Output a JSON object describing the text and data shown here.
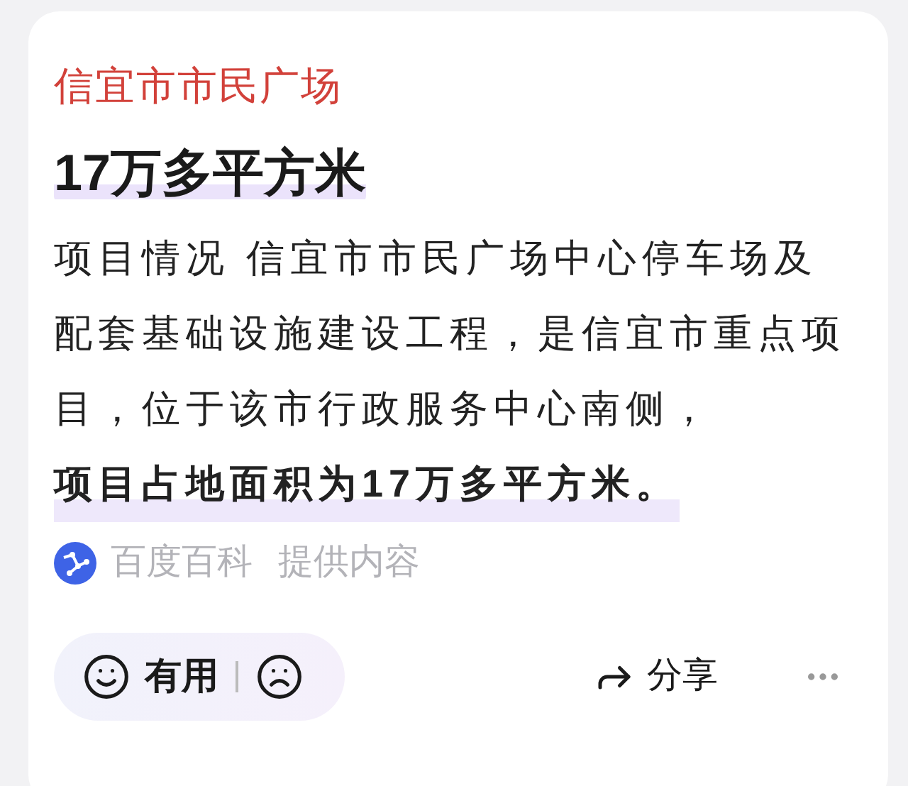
{
  "card": {
    "title": "信宜市市民广场",
    "answer": "17万多平方米",
    "paragraph": "项目情况 信宜市市民广场中心停车场及配套基础设施建设工程，是信宜市重点项目，位于该市行政服务中心南侧，**项目占地面积为17万多平方米。**",
    "source": {
      "name": "百度百科",
      "note": "提供内容"
    },
    "actions": {
      "useful": "有用",
      "share": "分享"
    }
  }
}
